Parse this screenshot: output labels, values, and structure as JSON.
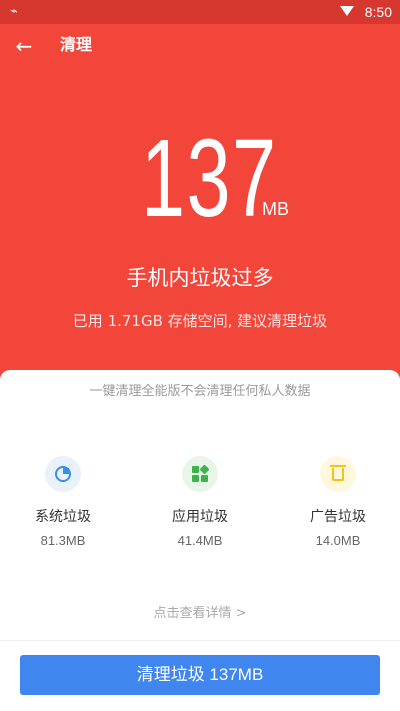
{
  "status_bar": {
    "time": "8:50",
    "left_icon": "satellite-icon"
  },
  "header": {
    "title": "清理",
    "back_icon": "arrow-left-icon"
  },
  "summary": {
    "amount": "137",
    "unit": "MB",
    "headline": "手机内垃圾过多",
    "subline": "已用 1.71GB 存储空间, 建议清理垃圾"
  },
  "card": {
    "notice": "一键清理全能版不会清理任何私人数据",
    "categories": [
      {
        "name": "系统垃圾",
        "size": "81.3MB",
        "icon": "pie-chart-icon",
        "color": "#3a8ee6"
      },
      {
        "name": "应用垃圾",
        "size": "41.4MB",
        "icon": "app-grid-icon",
        "color": "#3cb44b"
      },
      {
        "name": "广告垃圾",
        "size": "14.0MB",
        "icon": "trash-icon",
        "color": "#f5c21b"
      }
    ],
    "details_link": "点击查看详情 >"
  },
  "action": {
    "clean_label": "清理垃圾 137MB"
  },
  "colors": {
    "hero": "#f2463b",
    "button": "#3f86ee"
  }
}
